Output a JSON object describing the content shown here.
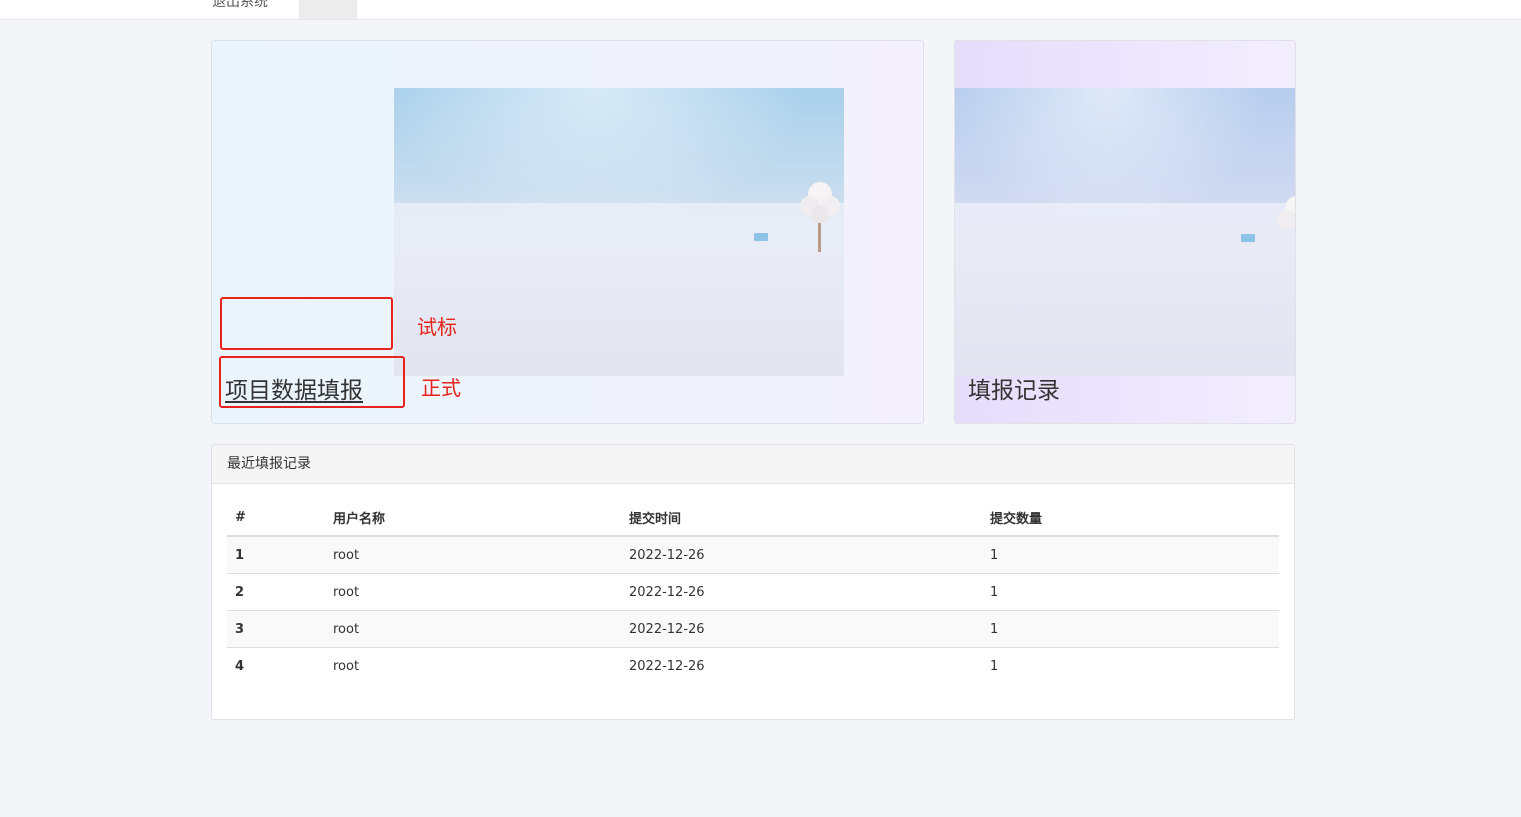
{
  "topbar": {
    "nav_text": "退出系统"
  },
  "cards": {
    "main_title": "项目数据填报",
    "records_title": "填报记录"
  },
  "annotations": {
    "trial_label": "试标",
    "formal_label": "正式",
    "color": "#e8231b"
  },
  "recent": {
    "heading": "最近填报记录",
    "columns": [
      "#",
      "用户名称",
      "提交时间",
      "提交数量"
    ],
    "rows": [
      {
        "idx": "1",
        "user": "root",
        "time": "2022-12-26",
        "count": "1"
      },
      {
        "idx": "2",
        "user": "root",
        "time": "2022-12-26",
        "count": "1"
      },
      {
        "idx": "3",
        "user": "root",
        "time": "2022-12-26",
        "count": "1"
      },
      {
        "idx": "4",
        "user": "root",
        "time": "2022-12-26",
        "count": "1"
      }
    ]
  }
}
